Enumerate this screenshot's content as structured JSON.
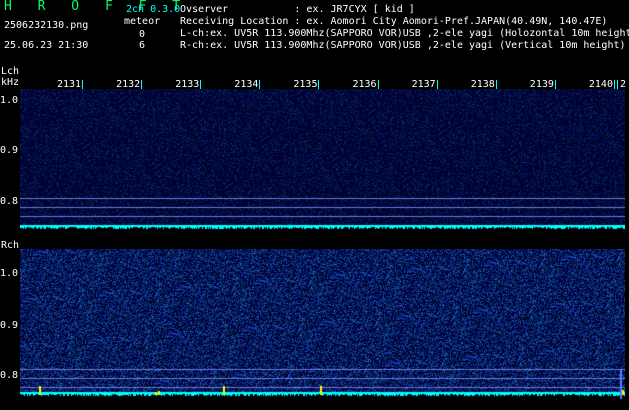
{
  "app": {
    "title": "H R O F F T",
    "version": "2ch 0.3.0"
  },
  "file": {
    "name": "2506232130.png",
    "datetime": "25.06.23 21:30"
  },
  "meteor": {
    "label": "meteor",
    "lch_count": "0",
    "rch_count": "6"
  },
  "info": {
    "observer": "Ovserver           : ex. JR7CYX [ kid ]",
    "location": "Receiving Location : ex. Aomori City Aomori-Pref.JAPAN(40.49N, 140.47E)",
    "lch": "L-ch:ex. UV5R 113.900Mhz(SAPPORO VOR)USB ,2-ele yagi (Holozontal 10m height",
    "rch": "R-ch:ex. UV5R 113.900Mhz(SAPPORO VOR)USB ,2-ele yagi (Vertical 10m height)"
  },
  "panels": {
    "lch": {
      "label": "Lch",
      "unit": "kHz",
      "yticks": [
        "1.0",
        "0.9",
        "0.8"
      ]
    },
    "rch": {
      "label": "Rch",
      "yticks": [
        "1.0",
        "0.9",
        "0.8"
      ]
    }
  },
  "time_axis": {
    "labels": [
      "2131",
      "2132",
      "2133",
      "2134",
      "2135",
      "2136",
      "2137",
      "2138",
      "2139",
      "2140",
      "2"
    ]
  },
  "colors": {
    "bg": "#000000",
    "noise_low": "#0a1a6e",
    "noise_high": "#4b7cff",
    "baseline": "#00ffff",
    "text_green": "#17ff5a",
    "meteor": "#ffff00"
  }
}
